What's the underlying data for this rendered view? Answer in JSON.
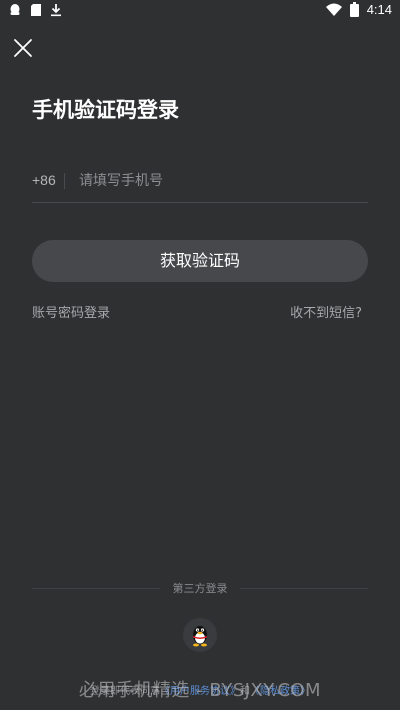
{
  "status_bar": {
    "time": "4:14",
    "left_icons": [
      "qq-notification-icon",
      "sim-icon",
      "download-icon"
    ],
    "right_icons": [
      "wifi-icon",
      "battery-icon"
    ]
  },
  "close_icon": "close-icon",
  "title": "手机验证码登录",
  "phone": {
    "country_code": "+86",
    "placeholder": "请填写手机号",
    "value": ""
  },
  "get_code_button": "获取验证码",
  "links": {
    "password_login": "账号密码登录",
    "no_code": "收不到短信?"
  },
  "third_party": {
    "title": "第三方登录",
    "qq_icon": "qq-penguin-icon"
  },
  "agreement": {
    "prefix": "登录即代表同意",
    "service": "《用户服务协议》",
    "and": "和",
    "privacy": "《隐私政策》"
  },
  "watermark": "必用手机精选 - BYSJXY.COM",
  "colors": {
    "background": "#2f3032",
    "button": "#47484b",
    "link": "#5d8fd6"
  }
}
